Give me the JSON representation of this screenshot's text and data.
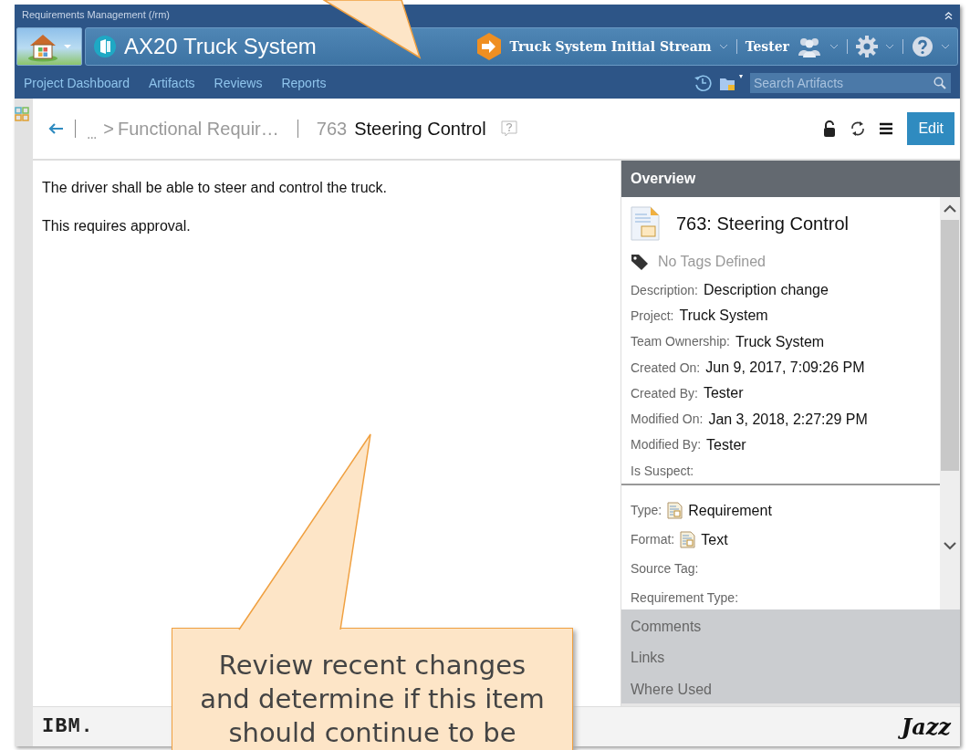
{
  "app_title": "Requirements Management (/rm)",
  "project": {
    "name": "AX20 Truck System"
  },
  "stream": "Truck System Initial Stream",
  "user": "Tester",
  "nav": [
    {
      "label": "Project Dashboard"
    },
    {
      "label": "Artifacts"
    },
    {
      "label": "Reviews"
    },
    {
      "label": "Reports"
    }
  ],
  "search": {
    "placeholder": "Search Artifacts"
  },
  "breadcrumb": {
    "ellipsis": "...",
    "separator": ">",
    "parent": "Functional Requir…"
  },
  "artifact": {
    "id": "763",
    "title": "Steering Control"
  },
  "edit_button": "Edit",
  "body": [
    "The driver shall be able to steer and control the truck.",
    "This requires approval."
  ],
  "overview": {
    "title": "Overview",
    "heading": "763: Steering Control",
    "tags": "No Tags Defined",
    "fields": [
      {
        "label": "Description:",
        "value": "Description change"
      },
      {
        "label": "Project:",
        "value": "Truck System"
      },
      {
        "label": "Team Ownership:",
        "value": "Truck System"
      },
      {
        "label": "Created On:",
        "value": "Jun 9, 2017, 7:09:26 PM"
      },
      {
        "label": "Created By:",
        "value": "Tester"
      },
      {
        "label": "Modified On:",
        "value": "Jan 3, 2018, 2:27:29 PM"
      },
      {
        "label": "Modified By:",
        "value": "Tester"
      },
      {
        "label": "Is Suspect:"
      }
    ],
    "type_fields": [
      {
        "kind": "icon",
        "label": "Type:",
        "value": "Requirement"
      },
      {
        "kind": "icon",
        "label": "Format:",
        "value": "Text"
      },
      {
        "kind": "plain",
        "label": "Source Tag:"
      },
      {
        "kind": "plain",
        "label": "Requirement Type:"
      }
    ]
  },
  "sections": [
    {
      "label": "Comments"
    },
    {
      "label": "Links"
    },
    {
      "label": "Where Used"
    }
  ],
  "footer": {
    "left_logo": "IBM.",
    "right_logo": "Jazz"
  },
  "callout": {
    "text": "Review recent changes and determine if this item should continue to be"
  }
}
